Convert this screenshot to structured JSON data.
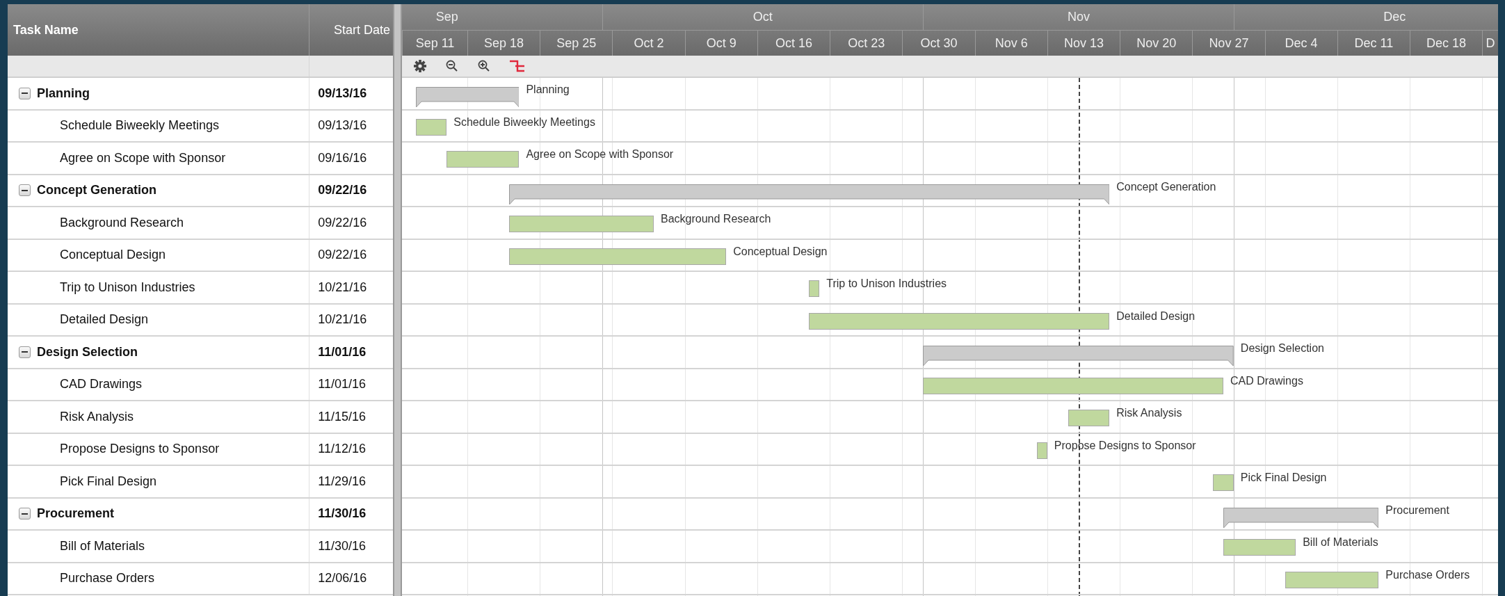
{
  "columns": {
    "task_name": "Task Name",
    "start_date": "Start Date"
  },
  "timeline": {
    "months": [
      "Sep",
      "Oct",
      "Nov",
      "Dec"
    ],
    "weeks": [
      "Sep 11",
      "Sep 18",
      "Sep 25",
      "Oct 2",
      "Oct 9",
      "Oct 16",
      "Oct 23",
      "Oct 30",
      "Nov 6",
      "Nov 13",
      "Nov 20",
      "Nov 27",
      "Dec 4",
      "Dec 11",
      "Dec 18",
      "D"
    ]
  },
  "tasks": [
    {
      "name": "Planning",
      "start_date": "09/13/16",
      "bar_label": "Planning",
      "expanded": true,
      "children": [
        {
          "name": "Schedule Biweekly Meetings",
          "start_date": "09/13/16",
          "bar_label": "Schedule Biweekly Meetings"
        },
        {
          "name": "Agree on Scope with Sponsor",
          "start_date": "09/16/16",
          "bar_label": "Agree on Scope with Sponsor"
        }
      ]
    },
    {
      "name": "Concept Generation",
      "start_date": "09/22/16",
      "bar_label": "Concept Generation",
      "expanded": true,
      "children": [
        {
          "name": "Background Research",
          "start_date": "09/22/16",
          "bar_label": "Background Research"
        },
        {
          "name": "Conceptual Design",
          "start_date": "09/22/16",
          "bar_label": "Conceptual Design"
        },
        {
          "name": "Trip to Unison Industries",
          "start_date": "10/21/16",
          "bar_label": "Trip to Unison Industries"
        },
        {
          "name": "Detailed Design",
          "start_date": "10/21/16",
          "bar_label": "Detailed Design"
        }
      ]
    },
    {
      "name": "Design Selection",
      "start_date": "11/01/16",
      "bar_label": "Design Selection",
      "expanded": true,
      "children": [
        {
          "name": "CAD Drawings",
          "start_date": "11/01/16",
          "bar_label": "CAD Drawings"
        },
        {
          "name": "Risk Analysis",
          "start_date": "11/15/16",
          "bar_label": "Risk Analysis"
        },
        {
          "name": "Propose Designs to Sponsor",
          "start_date": "11/12/16",
          "bar_label": "Propose Designs to Sponsor"
        },
        {
          "name": "Pick Final Design",
          "start_date": "11/29/16",
          "bar_label": "Pick Final Design"
        }
      ]
    },
    {
      "name": "Procurement",
      "start_date": "11/30/16",
      "bar_label": "Procurement",
      "expanded": true,
      "children": [
        {
          "name": "Bill of Materials",
          "start_date": "11/30/16",
          "bar_label": "Bill of Materials"
        },
        {
          "name": "Purchase Orders",
          "start_date": "12/06/16",
          "bar_label": "Purchase Orders"
        }
      ]
    }
  ]
}
